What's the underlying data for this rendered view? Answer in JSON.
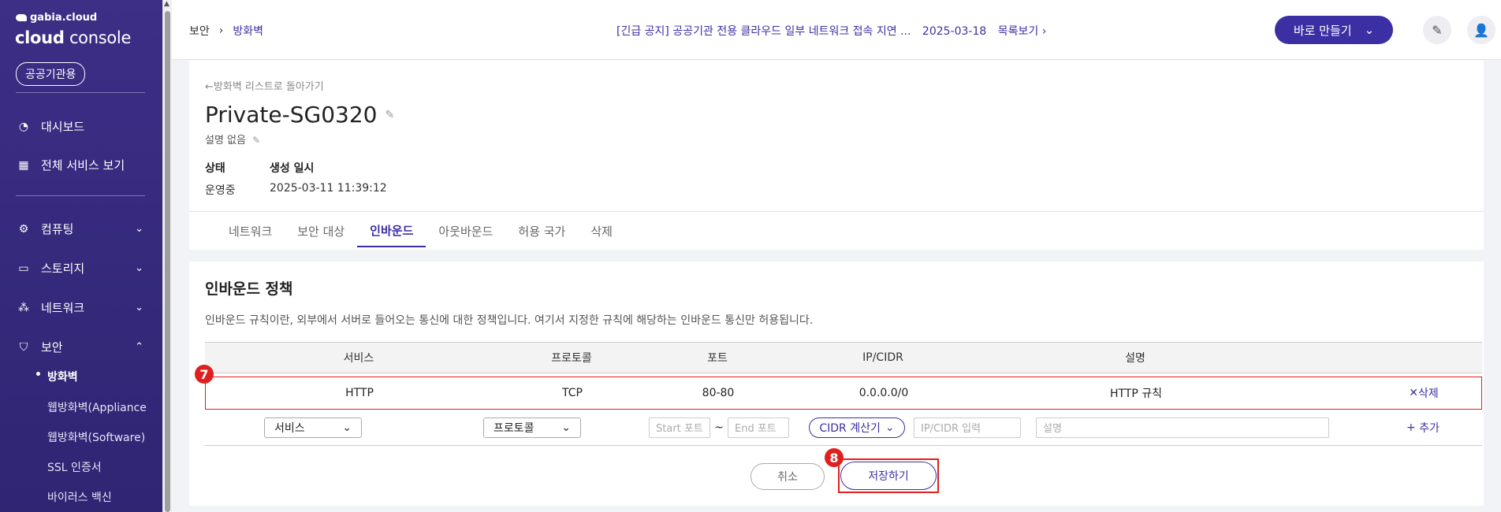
{
  "sidebar": {
    "brand_small": "gabia.cloud",
    "brand_big_bold": "cloud",
    "brand_big_rest": " console",
    "badge": "공공기관용",
    "items": [
      {
        "label": "대시보드"
      },
      {
        "label": "전체 서비스 보기"
      },
      {
        "label": "컴퓨팅"
      },
      {
        "label": "스토리지"
      },
      {
        "label": "네트워크"
      },
      {
        "label": "보안"
      }
    ],
    "subitems": [
      {
        "label": "방화벽"
      },
      {
        "label": "웹방화벽(Appliance"
      },
      {
        "label": "웹방화벽(Software)"
      },
      {
        "label": "SSL 인증서"
      },
      {
        "label": "바이러스 백신"
      }
    ]
  },
  "topbar": {
    "breadcrumb": [
      "보안",
      "방화벽"
    ],
    "notice": "[긴급 공지] 공공기관 전용 클라우드 일부 네트워크 접속 지연 ...",
    "notice_date": "2025-03-18",
    "notice_more": "목록보기",
    "make_button": "바로 만들기"
  },
  "header": {
    "back_link": "방화벽 리스트로 돌아가기",
    "title": "Private-SG0320",
    "description": "설명 없음",
    "status_label": "상태",
    "status_value": "운영중",
    "created_label": "생성 일시",
    "created_value": "2025-03-11 11:39:12",
    "tabs": [
      {
        "label": "네트워크"
      },
      {
        "label": "보안 대상"
      },
      {
        "label": "인바운드"
      },
      {
        "label": "아웃바운드"
      },
      {
        "label": "허용 국가"
      },
      {
        "label": "삭제"
      }
    ]
  },
  "policy": {
    "title": "인바운드 정책",
    "description": "인바운드 규칙이란, 외부에서 서버로 들어오는 통신에 대한 정책입니다. 여기서 지정한 규칙에 해당하는 인바운드 통신만 허용됩니다.",
    "columns": [
      "서비스",
      "프로토콜",
      "포트",
      "IP/CIDR",
      "설명"
    ],
    "rows": [
      {
        "service": "HTTP",
        "protocol": "TCP",
        "port": "80-80",
        "cidr": "0.0.0.0/0",
        "desc": "HTTP 규칙",
        "action": "삭제"
      }
    ],
    "new_row": {
      "service": "서비스",
      "protocol": "프로토콜",
      "start_port_placeholder": "Start 포트",
      "tilde": "~",
      "end_port_placeholder": "End 포트",
      "cidr_button": "CIDR 계산기",
      "cidr_placeholder": "IP/CIDR 입력",
      "desc_placeholder": "설명",
      "add": "추가"
    },
    "cancel_button": "취소",
    "save_button": "저장하기"
  },
  "markers": [
    "7",
    "8"
  ],
  "colors": {
    "accent": "#3b2fa3",
    "highlight": "#e02020",
    "sidebar": "#34287a"
  }
}
